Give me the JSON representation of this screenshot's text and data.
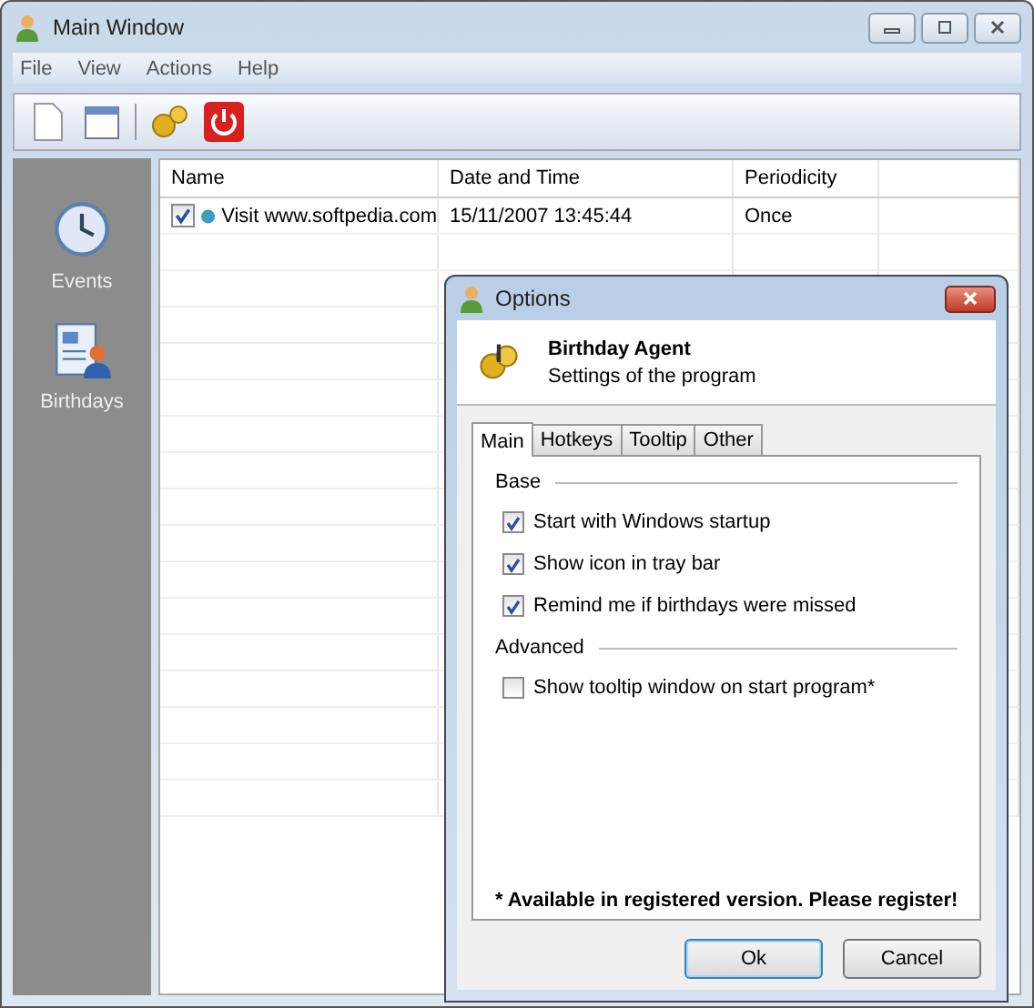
{
  "window": {
    "title": "Main Window"
  },
  "menu": [
    "File",
    "View",
    "Actions",
    "Help"
  ],
  "sidebar": {
    "items": [
      {
        "label": "Events",
        "kind": "clock"
      },
      {
        "label": "Birthdays",
        "kind": "card"
      }
    ]
  },
  "table": {
    "columns": [
      "Name",
      "Date and Time",
      "Periodicity"
    ],
    "rows": [
      {
        "checked": true,
        "name": "Visit www.softpedia.com",
        "date": "15/11/2007 13:45:44",
        "periodicity": "Once"
      }
    ]
  },
  "dialog": {
    "title": "Options",
    "heading": "Birthday Agent",
    "subtitle": "Settings of the program",
    "tabs": [
      {
        "label": "Main",
        "selected": true
      },
      {
        "label": "Hotkeys",
        "selected": false
      },
      {
        "label": "Tooltip",
        "selected": false
      },
      {
        "label": "Other",
        "selected": false
      }
    ],
    "groups": [
      {
        "title": "Base",
        "options": [
          {
            "label": "Start with Windows startup",
            "checked": true
          },
          {
            "label": "Show icon in tray bar",
            "checked": true
          },
          {
            "label": "Remind me if birthdays were missed",
            "checked": true
          }
        ]
      },
      {
        "title": "Advanced",
        "options": [
          {
            "label": "Show tooltip window on start program*",
            "checked": false
          }
        ]
      }
    ],
    "note": "* Available in registered version. Please register!",
    "buttons": [
      {
        "label": "Ok",
        "kind": "default"
      },
      {
        "label": "Cancel",
        "kind": "normal"
      }
    ]
  }
}
